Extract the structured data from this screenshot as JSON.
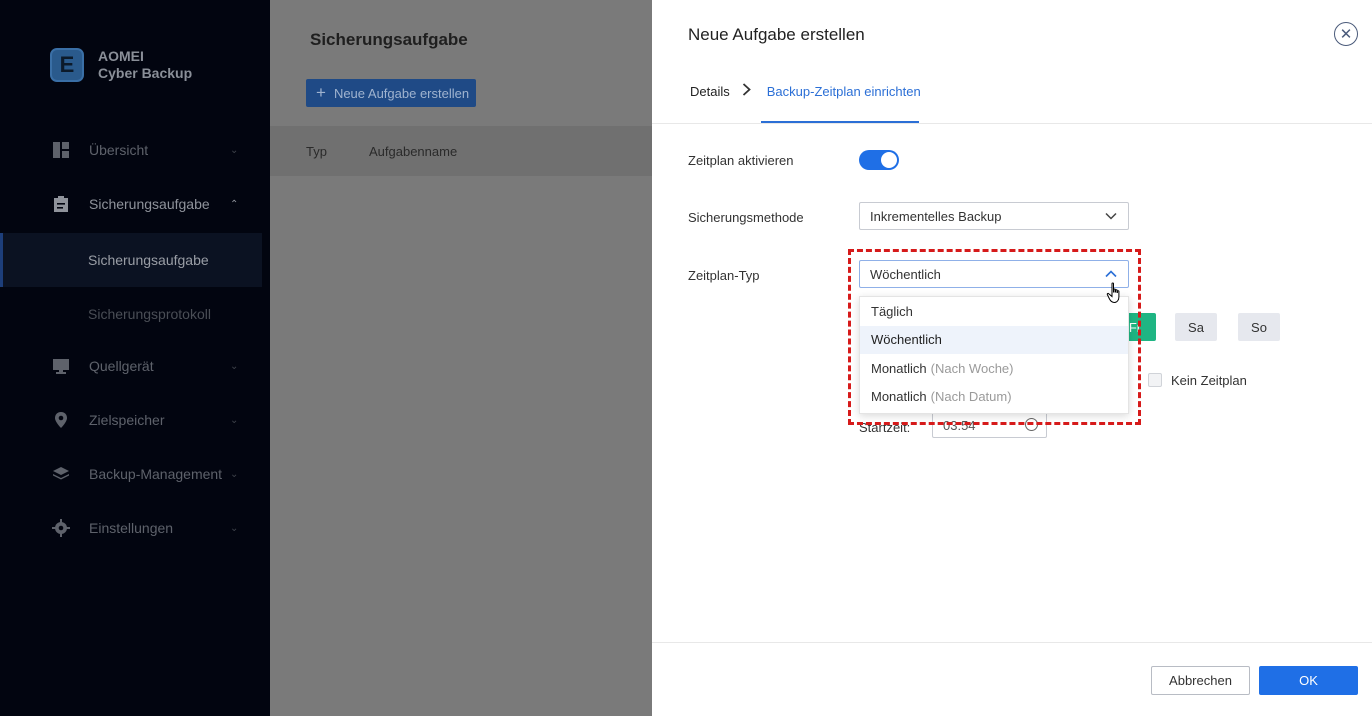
{
  "sidebar": {
    "logo_line1": "AOMEI",
    "logo_line2": "Cyber Backup",
    "logo_glyph": "E",
    "items": [
      {
        "label": "Übersicht",
        "icon": "dashboard-icon"
      },
      {
        "label": "Sicherungsaufgabe",
        "icon": "clipboard-icon"
      },
      {
        "label": "Quellgerät",
        "icon": "monitor-icon"
      },
      {
        "label": "Zielspeicher",
        "icon": "location-pin-icon"
      },
      {
        "label": "Backup-Management",
        "icon": "layers-icon"
      },
      {
        "label": "Einstellungen",
        "icon": "gear-icon"
      }
    ],
    "subitems": [
      {
        "label": "Sicherungsaufgabe",
        "selected": true
      },
      {
        "label": "Sicherungsprotokoll",
        "selected": false
      }
    ]
  },
  "main": {
    "title": "Sicherungsaufgabe",
    "new_task_button": "Neue Aufgabe erstellen",
    "columns": [
      "Typ",
      "Aufgabenname"
    ]
  },
  "dialog": {
    "title": "Neue Aufgabe erstellen",
    "breadcrumb": {
      "step1": "Details",
      "step2": "Backup-Zeitplan einrichten"
    },
    "schedule_enable_label": "Zeitplan aktivieren",
    "schedule_enabled": true,
    "method_label": "Sicherungsmethode",
    "method_value": "Inkrementelles Backup",
    "schedule_type_label": "Zeitplan-Typ",
    "schedule_type_value": "Wöchentlich",
    "dropdown_options": [
      {
        "label": "Täglich",
        "hint": ""
      },
      {
        "label": "Wöchentlich",
        "hint": ""
      },
      {
        "label": "Monatlich",
        "hint": "(Nach Woche)"
      },
      {
        "label": "Monatlich",
        "hint": "(Nach Datum)"
      }
    ],
    "days": [
      {
        "label": "Fr",
        "on": true
      },
      {
        "label": "Sa",
        "on": false
      },
      {
        "label": "So",
        "on": false
      }
    ],
    "no_schedule_label": "Kein Zeitplan",
    "start_time_label": "Startzeit:",
    "start_time_value": "03:54",
    "cancel_label": "Abbrechen",
    "ok_label": "OK"
  },
  "colors": {
    "accent": "#1f6fe6",
    "day_active": "#1fb583",
    "highlight_dashed": "#d61a1a",
    "sidebar_bg": "#020510"
  }
}
